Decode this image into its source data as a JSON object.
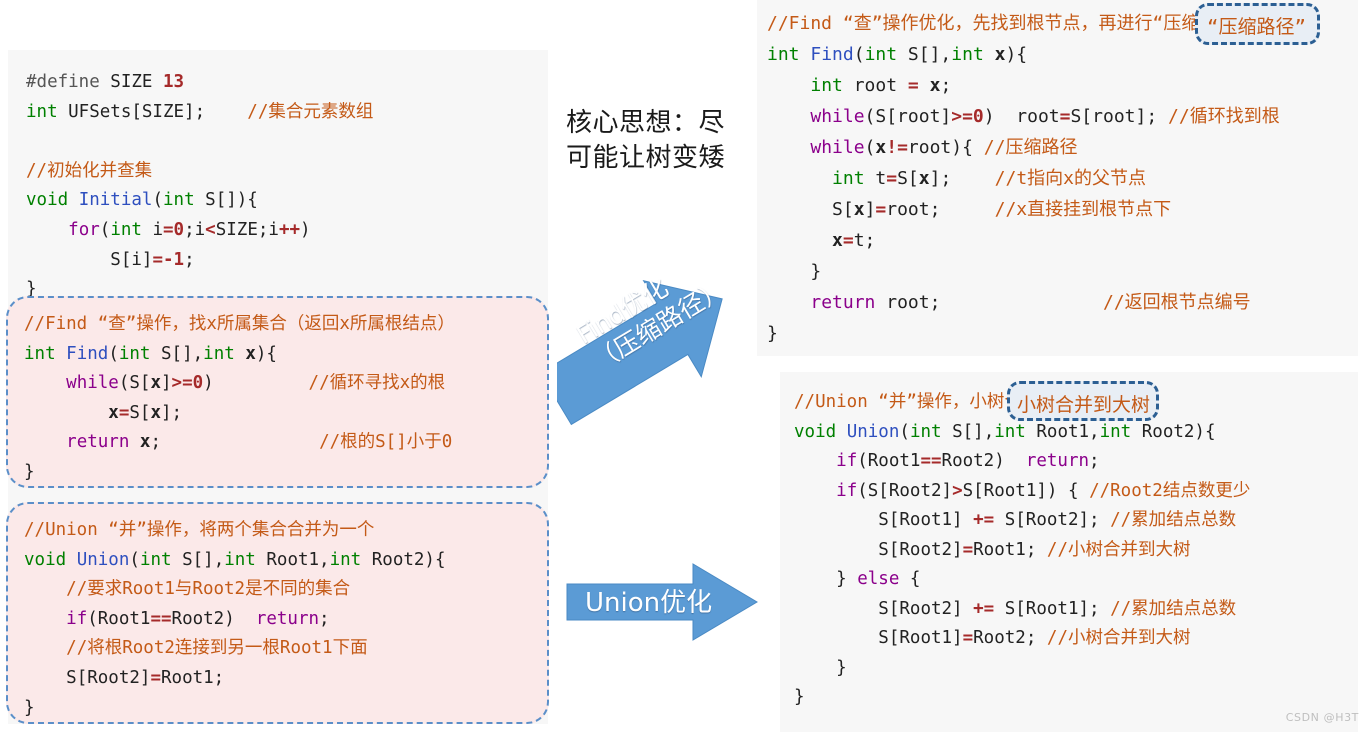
{
  "colors": {
    "panel_bg": "#f7f7f7",
    "pink_block_bg": "#fbe9e9",
    "dashed_border_blue": "#5b8fc9",
    "highlight_border": "#2c5f93",
    "highlight_fill": "#e8eef5",
    "arrow_blue": "#5b9bd5",
    "comment_orange": "#c45a17",
    "keyword_purple": "#8b008b",
    "type_green": "#008000",
    "function_blue": "#2e4fbf",
    "operator_red": "#a52a2a"
  },
  "left_panel": {
    "basic_code": [
      "#define SIZE 13",
      "int UFSets[SIZE];    //集合元素数组",
      "",
      "//初始化并查集",
      "void Initial(int S[]){",
      "    for(int i=0;i<SIZE;i++)",
      "        S[i]=-1;",
      "}"
    ],
    "find_block": {
      "title_comment": "//Find “查”操作，找x所属集合（返回x所属根结点）",
      "lines": [
        "//Find “查”操作，找x所属集合（返回x所属根结点）",
        "int Find(int S[],int x){",
        "    while(S[x]>=0)          //循环寻找x的根",
        "        x=S[x];",
        "    return x;               //根的S[]小于0",
        "}"
      ]
    },
    "union_block": {
      "title_comment": "//Union “并”操作，将两个集合合并为一个",
      "lines": [
        "//Union “并”操作，将两个集合合并为一个",
        "void Union(int S[],int Root1,int Root2){",
        "    //要求Root1与Root2是不同的集合",
        "    if(Root1==Root2)  return;",
        "    //将根Root2连接到另一根Root1下面",
        "    S[Root2]=Root1;",
        "}"
      ]
    }
  },
  "middle": {
    "core_idea_line1": "核心思想：尽",
    "core_idea_line2": "可能让树变矮",
    "find_arrow_line1": "Find优化",
    "find_arrow_line2": "（压缩路径）",
    "union_arrow_label": "Union优化"
  },
  "right_top_panel": {
    "lines": [
      "//Find “查”操作优化，先找到根节点，再进行“压缩路径”",
      "int Find(int S[],int x){",
      "    int root = x;",
      "    while(S[root]>=0)  root=S[root]; //循环找到根",
      "    while(x!=root){ //压缩路径",
      "      int t=S[x];    //t指向x的父节点",
      "      S[x]=root;     //x直接挂到根节点下",
      "      x=t;",
      "    }",
      "    return root;               //返回根节点编号",
      "}"
    ],
    "highlight_text": "“压缩路径”"
  },
  "right_bottom_panel": {
    "lines": [
      "//Union “并”操作，小树合并到大树",
      "void Union(int S[],int Root1,int Root2){",
      "    if(Root1==Root2)  return;",
      "    if(S[Root2]>S[Root1]) { //Root2结点数更少",
      "        S[Root1] += S[Root2]; //累加结点总数",
      "        S[Root2]=Root1; //小树合并到大树",
      "    } else {",
      "        S[Root2] += S[Root1]; //累加结点总数",
      "        S[Root1]=Root2; //小树合并到大树",
      "    }",
      "}"
    ],
    "highlight_text": "小树合并到大树"
  },
  "watermark": "CSDN @H3T"
}
